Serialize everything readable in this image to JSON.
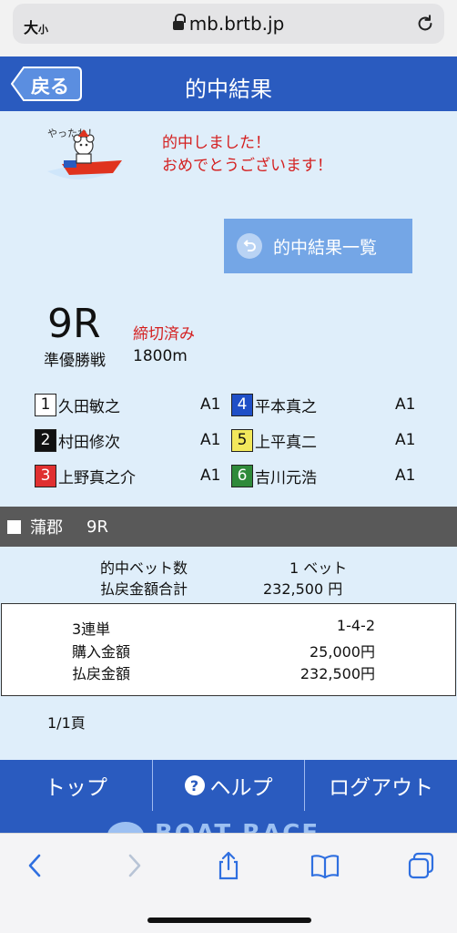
{
  "browser": {
    "text_size_label": "大",
    "text_size_small": "小",
    "url": "mb.brtb.jp"
  },
  "header": {
    "back_label": "戻る",
    "title": "的中結果"
  },
  "banner": {
    "mascot_caption": "やったね！",
    "message_line1": "的中しました！",
    "message_line2": "おめでとうございます！"
  },
  "list_button": {
    "label": "的中結果一覧"
  },
  "race": {
    "number": "9R",
    "status": "締切済み",
    "name": "準優勝戦",
    "distance": "1800m"
  },
  "racers": [
    {
      "lane": "1",
      "name": "久田敏之",
      "class": "A1",
      "lane_bg": "#ffffff",
      "lane_fg": "#111111"
    },
    {
      "lane": "2",
      "name": "村田修次",
      "class": "A1",
      "lane_bg": "#111111",
      "lane_fg": "#ffffff"
    },
    {
      "lane": "3",
      "name": "上野真之介",
      "class": "A1",
      "lane_bg": "#e03030",
      "lane_fg": "#ffffff"
    },
    {
      "lane": "4",
      "name": "平本真之",
      "class": "A1",
      "lane_bg": "#1f4fc7",
      "lane_fg": "#ffffff"
    },
    {
      "lane": "5",
      "name": "上平真二",
      "class": "A1",
      "lane_bg": "#f2e85c",
      "lane_fg": "#111111"
    },
    {
      "lane": "6",
      "name": "吉川元浩",
      "class": "A1",
      "lane_bg": "#2f8a3a",
      "lane_fg": "#ffffff"
    }
  ],
  "section": {
    "venue": "蒲郡",
    "race": "9R"
  },
  "summary": {
    "bet_count_label": "的中ベット数",
    "bet_count_value": "1 ベット",
    "payout_total_label": "払戻金額合計",
    "payout_total_value": "232,500 円"
  },
  "bet": {
    "type": "3連単",
    "combination": "1-4-2",
    "purchase_label": "購入金額",
    "purchase_value": "25,000円",
    "payout_label": "払戻金額",
    "payout_value": "232,500円"
  },
  "pagination": {
    "label": "1/1頁"
  },
  "nav": {
    "top": "トップ",
    "help": "ヘルプ",
    "logout": "ログアウト"
  },
  "logo": {
    "text": "BOAT RACE"
  },
  "colors": {
    "primary": "#2a5bbf",
    "accent_red": "#d42020",
    "page_bg": "#dfeefa"
  }
}
